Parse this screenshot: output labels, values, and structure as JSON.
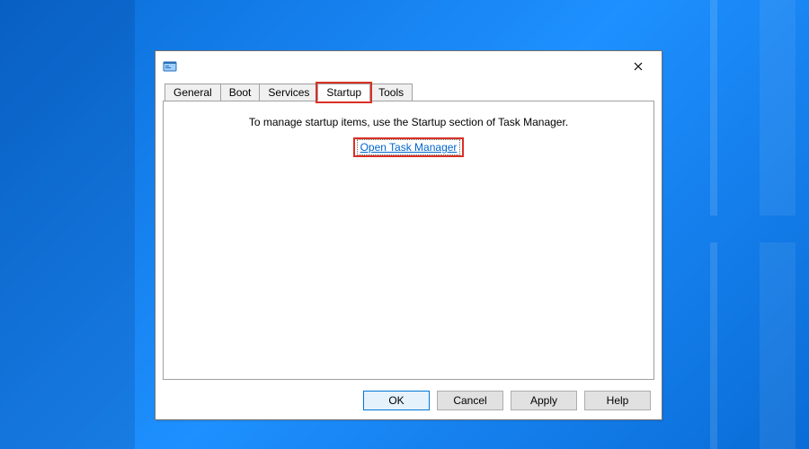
{
  "window": {
    "title": ""
  },
  "tabs": {
    "general": "General",
    "boot": "Boot",
    "services": "Services",
    "startup": "Startup",
    "tools": "Tools",
    "active": "startup"
  },
  "content": {
    "message": "To manage startup items, use the Startup section of Task Manager.",
    "link": "Open Task Manager"
  },
  "buttons": {
    "ok": "OK",
    "cancel": "Cancel",
    "apply": "Apply",
    "help": "Help"
  }
}
